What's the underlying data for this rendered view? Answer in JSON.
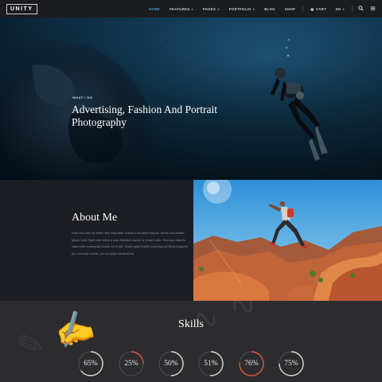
{
  "nav": {
    "logo": "UNITY",
    "items": [
      {
        "label": "HOME",
        "active": true,
        "dropdown": false
      },
      {
        "label": "FEATURES",
        "active": false,
        "dropdown": true
      },
      {
        "label": "PAGES",
        "active": false,
        "dropdown": true
      },
      {
        "label": "PORTFOLIO",
        "active": false,
        "dropdown": true
      },
      {
        "label": "BLOG",
        "active": false,
        "dropdown": false
      },
      {
        "label": "SHOP",
        "active": false,
        "dropdown": false
      },
      {
        "label": "CART",
        "active": false,
        "dropdown": false
      },
      {
        "label": "EN",
        "active": false,
        "dropdown": true
      }
    ],
    "accent_color": "#3aa4d6"
  },
  "hero": {
    "eyebrow": "WHAT I DO",
    "title": "Advertising, Fashion And Portrait Photography"
  },
  "about": {
    "title": "About Me",
    "body": "Duis sed odio sit amet nibh vulputate cursus a sit amet mauris. Morbi accumsan ipsum velit. Nam nec tellus a odio tincidunt auctor a ornare odio. Sed non mauris vitae erat consequat auctor eu in elit. Class aptent taciti sociosqu ad litora torquent per conubia nostra, per inceptos himenaeos."
  },
  "skills": {
    "title": "Skills",
    "items": [
      {
        "value": "65%",
        "percent": 65,
        "color": "#d9d9d9"
      },
      {
        "value": "25%",
        "percent": 25,
        "color": "#e0563b"
      },
      {
        "value": "50%",
        "percent": 50,
        "color": "#d9d9d9"
      },
      {
        "value": "51%",
        "percent": 51,
        "color": "#d9d9d9"
      },
      {
        "value": "76%",
        "percent": 76,
        "color": "#e0563b"
      },
      {
        "value": "75%",
        "percent": 75,
        "color": "#d9d9d9"
      }
    ]
  }
}
